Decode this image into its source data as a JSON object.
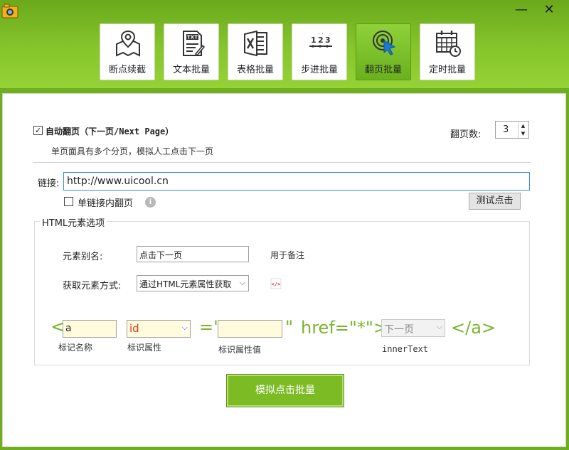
{
  "window": {
    "minimize_glyph": "—",
    "close_glyph": "✕"
  },
  "tabs": [
    {
      "label": "断点续截",
      "icon": "map-pin-icon"
    },
    {
      "label": "文本批量",
      "icon": "txt-file-icon"
    },
    {
      "label": "表格批量",
      "icon": "excel-icon"
    },
    {
      "label": "步进批量",
      "icon": "number-step-icon"
    },
    {
      "label": "翻页批量",
      "icon": "click-cursor-icon",
      "active": true
    },
    {
      "label": "定时批量",
      "icon": "calendar-clock-icon"
    }
  ],
  "auto_page": {
    "checked_glyph": "✓",
    "label": "自动翻页（下一页/Next Page）",
    "description": "单页面具有多个分页，模拟人工点击下一页",
    "page_count_label": "翻页数:",
    "page_count_value": "3"
  },
  "link": {
    "label": "链接:",
    "value": "http://www.uicool.cn",
    "single_link_label": "单链接内翻页",
    "test_button": "测试点击"
  },
  "html_group": {
    "title": "HTML元素选项",
    "alias_label": "元素别名:",
    "alias_value": "点击下一页",
    "alias_note": "用于备注",
    "method_label": "获取元素方式:",
    "method_value": "通过HTML元素属性获取"
  },
  "tag_builder": {
    "open_lt": "<",
    "tag_value": "a",
    "attr_value": "id",
    "equals_quote": "=\"",
    "attr_value_value": "",
    "close_quote": "\"",
    "href_text": "href=\"*\">",
    "inner_text_value": "下一页",
    "close_tag": "</a>",
    "tag_name_caption": "标记名称",
    "attr_caption": "标识属性",
    "attr_value_caption": "标识属性值",
    "inner_text_caption": "innerText"
  },
  "main_button": "模拟点击批量",
  "colors": {
    "accent_green": "#7ab52a",
    "button_green": "#7dbb25",
    "input_yellow": "#fffbdc"
  }
}
